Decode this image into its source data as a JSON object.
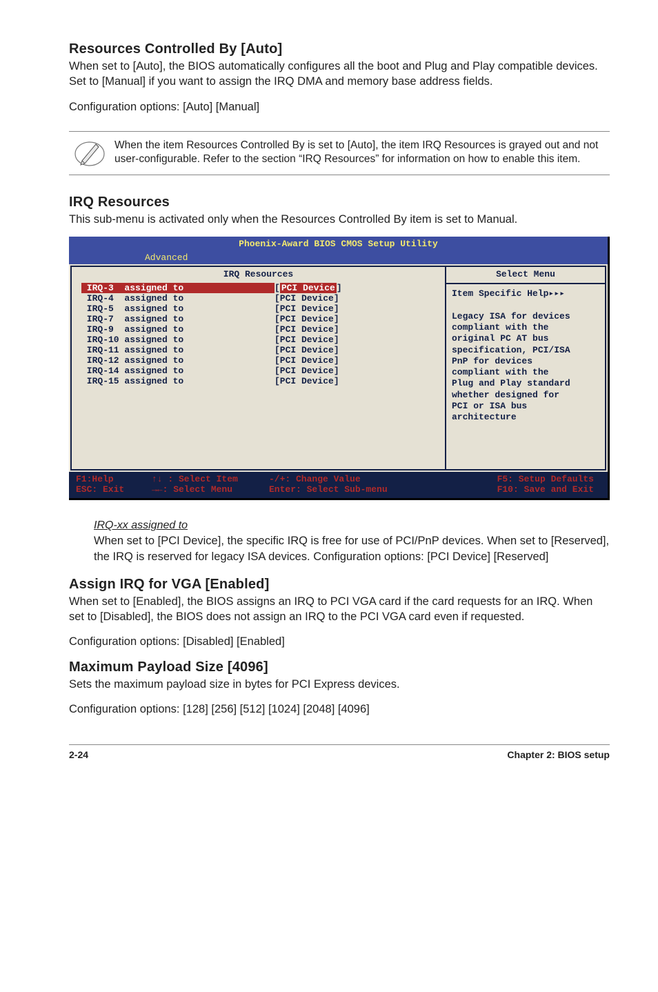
{
  "sections": {
    "rcb": {
      "title": "Resources Controlled By [Auto]",
      "body": "When set to [Auto], the BIOS automatically configures all the boot and Plug and Play compatible devices. Set to [Manual] if you want to assign the IRQ DMA and memory base address fields.",
      "opts": "Configuration options: [Auto] [Manual]"
    },
    "note": "When the item Resources Controlled By is set to [Auto], the item IRQ Resources is grayed out and not user-configurable. Refer to the section “IRQ Resources” for information on how to enable this item.",
    "irqres": {
      "title": "IRQ Resources",
      "body": "This sub-menu is activated only when the Resources Controlled By item is set to Manual."
    },
    "irqxx": {
      "title": "IRQ-xx assigned to",
      "body": "When set to [PCI Device], the specific IRQ is free for use of PCI/PnP devices. When set to [Reserved], the IRQ is reserved for legacy ISA devices. Configuration options: [PCI Device] [Reserved]"
    },
    "assignvga": {
      "title": "Assign IRQ for VGA [Enabled]",
      "body": "When set to [Enabled], the BIOS assigns an IRQ to PCI VGA card if the card requests for an IRQ. When set to [Disabled], the BIOS does not assign an IRQ to the PCI VGA card even if requested.",
      "opts": "Configuration options: [Disabled] [Enabled]"
    },
    "maxpayload": {
      "title": "Maximum Payload Size [4096]",
      "body": "Sets the maximum payload size in bytes for PCI Express devices.",
      "opts": "Configuration options: [128] [256] [512] [1024] [2048] [4096]"
    }
  },
  "bios": {
    "title": "Phoenix-Award BIOS CMOS Setup Utility",
    "tab": "Advanced",
    "panel_title": "IRQ Resources",
    "help_title": "Select Menu",
    "rows": [
      {
        "label": "IRQ-3  assigned to",
        "value": "PCI Device",
        "selected": true
      },
      {
        "label": "IRQ-4  assigned to",
        "value": "[PCI Device]"
      },
      {
        "label": "IRQ-5  assigned to",
        "value": "[PCI Device]"
      },
      {
        "label": "IRQ-7  assigned to",
        "value": "[PCI Device]"
      },
      {
        "label": "IRQ-9  assigned to",
        "value": "[PCI Device]"
      },
      {
        "label": "IRQ-10 assigned to",
        "value": "[PCI Device]"
      },
      {
        "label": "IRQ-11 assigned to",
        "value": "[PCI Device]"
      },
      {
        "label": "IRQ-12 assigned to",
        "value": "[PCI Device]"
      },
      {
        "label": "IRQ-14 assigned to",
        "value": "[PCI Device]"
      },
      {
        "label": "IRQ-15 assigned to",
        "value": "[PCI Device]"
      }
    ],
    "help_lines": [
      "Item Specific Help▸▸▸",
      "",
      "Legacy ISA for devices",
      "compliant with the",
      "original PC AT bus",
      "specification, PCI/ISA",
      "PnP for devices",
      "compliant with the",
      "Plug and Play standard",
      "whether designed for",
      "PCI or ISA bus",
      "architecture"
    ],
    "footer": {
      "r1c1": "F1:Help",
      "r1c2": "↑↓ : Select Item",
      "r1c3": "-/+: Change Value",
      "r1c4": "F5: Setup Defaults",
      "r2c1": "ESC: Exit",
      "r2c2": "→←: Select Menu",
      "r2c3": "Enter: Select Sub-menu",
      "r2c4": "F10: Save and Exit"
    }
  },
  "footer": {
    "page": "2-24",
    "chapter": "Chapter 2: BIOS setup"
  }
}
